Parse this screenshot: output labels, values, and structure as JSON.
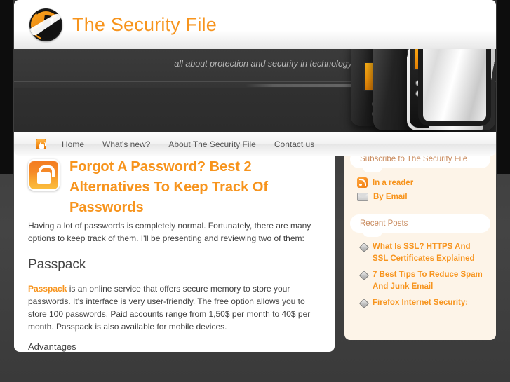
{
  "site": {
    "title": "The Security File",
    "tagline": "all about protection and security in technology",
    "logo_icon": "security-tower-logo-icon",
    "accent_color": "#f7941d",
    "page_background": "#3a3a3a",
    "sidebar_background": "#fdf4e8"
  },
  "nav": {
    "lock_icon": "lock-icon",
    "items": [
      {
        "label": "Home"
      },
      {
        "label": "What's new?"
      },
      {
        "label": "About The Security File"
      },
      {
        "label": "Contact us"
      }
    ]
  },
  "header_art": {
    "icon": "server-rack-icon",
    "units": [
      "black-server",
      "black-server",
      "silver-server"
    ]
  },
  "article": {
    "badge_icon": "padlock-icon",
    "title": "Forgot A Password? Best 2 Alternatives To Keep Track Of Passwords",
    "intro": "Having a lot of passwords is completely normal. Fortunately, there are many options to keep track of them. I'll be presenting and reviewing two of them:",
    "section_heading": "Passpack",
    "link_label": "Passpack",
    "section_body": " is an online service that offers secure memory to store your passwords. It's interface is very user-friendly. The free option allows you to store 100 passwords. Paid accounts range from 1,50$ per month to 40$ per month. Passpack is also available for mobile devices.",
    "sub_heading": "Advantages"
  },
  "sidebar": {
    "subscribe": {
      "title": "Subscribe to The Security File",
      "links": [
        {
          "label": "In a reader",
          "icon": "rss-icon"
        },
        {
          "label": "By Email",
          "icon": "email-icon"
        }
      ]
    },
    "recent": {
      "title": "Recent Posts",
      "bullet_icon": "diamond-bullet-icon",
      "posts": [
        {
          "label": "What Is SSL? HTTPS And SSL Certificates Explained"
        },
        {
          "label": "7 Best Tips To Reduce Spam And Junk Email"
        },
        {
          "label": "Firefox Internet Security:"
        }
      ]
    }
  }
}
